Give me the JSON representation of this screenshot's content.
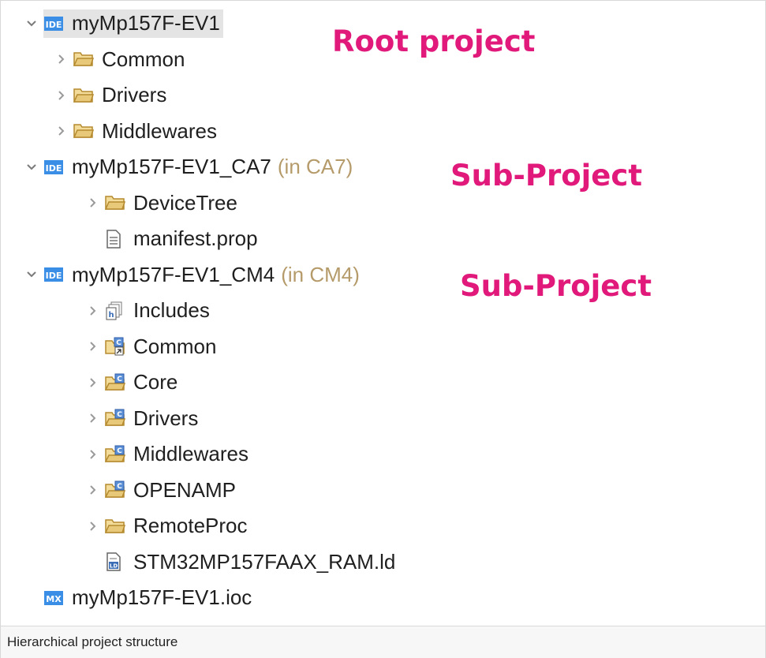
{
  "tree": {
    "root": {
      "label": "myMp157F-EV1",
      "icon": "ide-project-icon"
    },
    "root_children": [
      {
        "label": "Common",
        "icon": "folder-icon"
      },
      {
        "label": "Drivers",
        "icon": "folder-icon"
      },
      {
        "label": "Middlewares",
        "icon": "folder-icon"
      }
    ],
    "ca7": {
      "label": "myMp157F-EV1_CA7",
      "suffix": "(in CA7)",
      "icon": "ide-project-icon",
      "children": [
        {
          "label": "DeviceTree",
          "icon": "folder-icon"
        },
        {
          "label": "manifest.prop",
          "icon": "text-file-icon"
        }
      ]
    },
    "cm4": {
      "label": "myMp157F-EV1_CM4",
      "suffix": "(in CM4)",
      "icon": "ide-project-icon",
      "children": [
        {
          "label": "Includes",
          "icon": "includes-icon"
        },
        {
          "label": "Common",
          "icon": "linked-source-folder-icon"
        },
        {
          "label": "Core",
          "icon": "source-folder-icon"
        },
        {
          "label": "Drivers",
          "icon": "source-folder-icon"
        },
        {
          "label": "Middlewares",
          "icon": "source-folder-icon"
        },
        {
          "label": "OPENAMP",
          "icon": "source-folder-icon"
        },
        {
          "label": "RemoteProc",
          "icon": "folder-icon"
        },
        {
          "label": "STM32MP157FAAX_RAM.ld",
          "icon": "linker-file-icon"
        }
      ]
    },
    "ioc": {
      "label": "myMp157F-EV1.ioc",
      "icon": "mx-file-icon"
    }
  },
  "annotations": {
    "root": "Root project",
    "sub1": "Sub-Project",
    "sub2": "Sub-Project"
  },
  "caption": "Hierarchical project structure",
  "colors": {
    "annotation": "#e0197a",
    "folder": "#e8c97a",
    "ide_icon": "#3a8ee6",
    "suffix": "#b59a6a"
  }
}
